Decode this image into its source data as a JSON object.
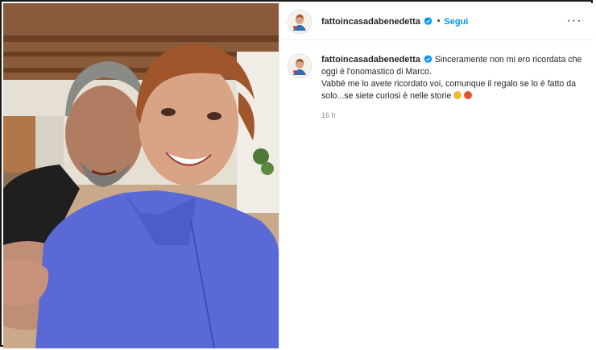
{
  "post": {
    "username": "fattoincasadabenedetta",
    "follow_label": "Segui",
    "separator": "•",
    "more_label": "···",
    "caption_lines": [
      "Sinceramente non mi ero ricordata che",
      "oggi è l'onomastico di Marco.",
      "Vabbè me lo avete ricordato voi, comunque il regalo se lo è fatto da",
      "solo...se siete curiosi è nelle storie"
    ],
    "timestamp": "16 h",
    "emojis": [
      "smiling-face-emoji",
      "angry-face-emoji"
    ]
  },
  "colors": {
    "follow": "#0095f6",
    "verified": "#0095f6",
    "text": "#262626",
    "muted": "#8e8e8e",
    "divider": "#efefef"
  },
  "icons": {
    "verified": "verified-badge-icon",
    "more": "more-options-icon"
  }
}
